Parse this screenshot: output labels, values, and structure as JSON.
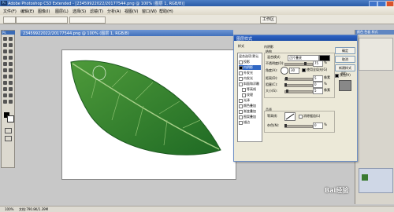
{
  "app": {
    "title": "Adobe Photoshop CS3 Extended - [23459922022/20177544.png @ 100% (图层 1, RGB/8)]",
    "logo": "Ps"
  },
  "menu": [
    "文件(F)",
    "编辑(E)",
    "图像(I)",
    "图层(L)",
    "选择(S)",
    "滤镜(T)",
    "分析(A)",
    "视图(V)",
    "窗口(W)",
    "帮助(H)"
  ],
  "options": {
    "workspace": "工作区"
  },
  "document_tab": "23459922022/20177544.png @ 100% (图层 1, RGB/8)",
  "status": {
    "zoom": "100%",
    "doc": "文档:790.8K/1.39M"
  },
  "panel_tabs": [
    "颜色",
    "色板",
    "样式"
  ],
  "dialog": {
    "title": "图层样式",
    "styles_header": "样式",
    "blend_default": "混合选项:默认",
    "styles": [
      {
        "label": "投影",
        "checked": false
      },
      {
        "label": "内阴影",
        "checked": true,
        "selected": true
      },
      {
        "label": "外发光",
        "checked": false
      },
      {
        "label": "内发光",
        "checked": false
      },
      {
        "label": "斜面和浮雕",
        "checked": false
      },
      {
        "label": "等高线",
        "checked": false
      },
      {
        "label": "纹理",
        "checked": false
      },
      {
        "label": "光泽",
        "checked": false
      },
      {
        "label": "颜色叠加",
        "checked": false
      },
      {
        "label": "渐变叠加",
        "checked": false
      },
      {
        "label": "图案叠加",
        "checked": false
      },
      {
        "label": "描边",
        "checked": false
      }
    ],
    "section_title": "内阴影",
    "structure": "结构",
    "blend_mode_label": "混合模式:",
    "blend_mode_value": "正片叠底",
    "opacity_label": "不透明度(O):",
    "opacity_value": "75",
    "angle_label": "角度(A):",
    "angle_value": "30",
    "global_light": "使用全局光(G)",
    "distance_label": "距离(D):",
    "distance_value": "5",
    "choke_label": "阻塞(C):",
    "choke_value": "0",
    "size_label": "大小(S):",
    "size_value": "5",
    "unit_px": "像素",
    "unit_pct": "%",
    "quality": "品质",
    "contour_label": "等高线:",
    "antialias": "消除锯齿(L)",
    "noise_label": "杂色(N):",
    "noise_value": "0",
    "ok": "确定",
    "cancel": "取消",
    "new_style": "新建样式(W)...",
    "preview": "预览(V)"
  },
  "watermark": "Bai经验",
  "colors": {
    "accent": "#3168c4",
    "leaf": "#2e7a2a"
  }
}
